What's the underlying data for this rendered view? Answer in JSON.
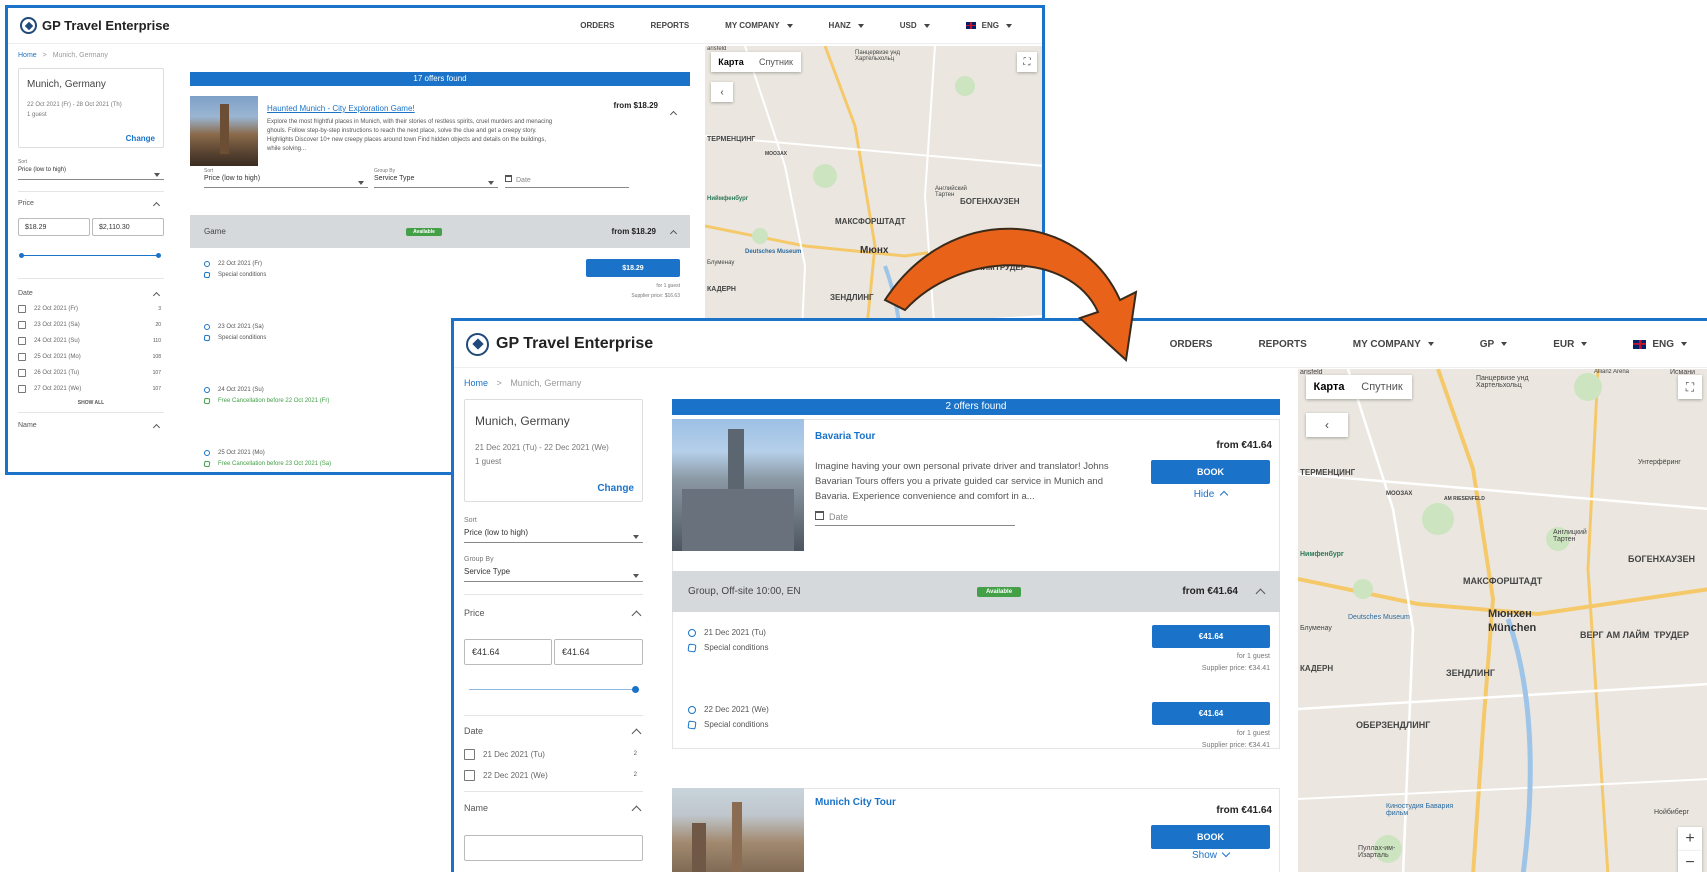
{
  "back": {
    "logo_text": "GP Travel Enterprise",
    "nav": {
      "orders": "ORDERS",
      "reports": "REPORTS",
      "company": "MY COMPANY",
      "user": "HANZ",
      "currency": "USD",
      "lang": "ENG"
    },
    "breadcrumb": {
      "home": "Home",
      "sep": ">",
      "current": "Munich, Germany"
    },
    "search": {
      "city": "Munich, Germany",
      "dates": "22 Oct 2021 (Fr) - 28 Oct 2021 (Th)",
      "guests": "1 guest",
      "change": "Change"
    },
    "sort": {
      "label": "Sort",
      "value": "Price (low to high)"
    },
    "price": {
      "title": "Price",
      "min": "$18.29",
      "max": "$2,110.30"
    },
    "date_filter": {
      "title": "Date",
      "items": [
        {
          "label": "22 Oct 2021 (Fr)",
          "count": "3"
        },
        {
          "label": "23 Oct 2021 (Sa)",
          "count": "20"
        },
        {
          "label": "24 Oct 2021 (Su)",
          "count": "110"
        },
        {
          "label": "25 Oct 2021 (Mo)",
          "count": "108"
        },
        {
          "label": "26 Oct 2021 (Tu)",
          "count": "107"
        },
        {
          "label": "27 Oct 2021 (We)",
          "count": "107"
        }
      ],
      "show_all": "SHOW ALL"
    },
    "name_filter": {
      "title": "Name"
    },
    "results_bar": "17 offers found",
    "offer": {
      "title": "Haunted Munich - City Exploration Game!",
      "price": "from $18.29",
      "desc": "Explore the most frightful places in Munich, with their stories of restless spirits, cruel murders and menacing ghouls. Follow step-by-step instructions to reach the next place, solve the clue and get a creepy story. Highlights Discover 10+ new creepy places around town Find hidden objects and details on the buildings, while solving..."
    },
    "controls": {
      "sort_label": "Sort",
      "sort_value": "Price (low to high)",
      "group_label": "Group By",
      "group_value": "Service Type",
      "date_placeholder": "Date"
    },
    "group": {
      "name": "Game",
      "badge": "Available",
      "price": "from $18.29"
    },
    "rows": [
      {
        "date": "22 Oct 2021 (Fr)",
        "cond": "Special conditions"
      },
      {
        "date": "23 Oct 2021 (Sa)",
        "cond": "Special conditions"
      },
      {
        "date": "24 Oct 2021 (Su)",
        "cond": "Free Cancellation before 22 Oct 2021 (Fr)"
      },
      {
        "date": "25 Oct 2021 (Mo)",
        "cond": "Free Cancellation before 23 Oct 2021 (Sa)"
      }
    ],
    "first_row": {
      "button": "$18.29",
      "for": "for 1 guest",
      "supplier": "Supplier price: $16.63"
    },
    "map": {
      "tab_map": "Карта",
      "tab_sat": "Спутник"
    }
  },
  "front": {
    "logo_text": "GP Travel Enterprise",
    "nav": {
      "orders": "ORDERS",
      "reports": "REPORTS",
      "company": "MY COMPANY",
      "user": "GP",
      "currency": "EUR",
      "lang": "ENG"
    },
    "breadcrumb": {
      "home": "Home",
      "sep": ">",
      "current": "Munich, Germany"
    },
    "search": {
      "city": "Munich, Germany",
      "dates": "21 Dec 2021 (Tu) - 22 Dec 2021 (We)",
      "guests": "1 guest",
      "change": "Change"
    },
    "sort": {
      "label": "Sort",
      "value": "Price (low to high)"
    },
    "group": {
      "label": "Group By",
      "value": "Service Type"
    },
    "price": {
      "title": "Price",
      "min": "€41.64",
      "max": "€41.64"
    },
    "date_filter": {
      "title": "Date",
      "items": [
        {
          "label": "21 Dec 2021 (Tu)",
          "count": "2"
        },
        {
          "label": "22 Dec 2021 (We)",
          "count": "2"
        }
      ]
    },
    "name_filter": {
      "title": "Name"
    },
    "results_bar": "2 offers found",
    "offer1": {
      "title": "Bavaria Tour",
      "price": "from €41.64",
      "desc": "Imagine having your own personal private driver and translator! Johns Bavarian Tours offers you a private guided car service in Munich and Bavaria. Experience convenience and comfort in a...",
      "book": "BOOK",
      "toggle": "Hide",
      "date_placeholder": "Date"
    },
    "group_row": {
      "name": "Group, Off-site 10:00, EN",
      "badge": "Available",
      "price": "from €41.64"
    },
    "rows": [
      {
        "date": "21 Dec 2021 (Tu)",
        "cond": "Special conditions",
        "button": "€41.64",
        "for": "for 1 guest",
        "supplier": "Supplier price: €34.41"
      },
      {
        "date": "22 Dec 2021 (We)",
        "cond": "Special conditions",
        "button": "€41.64",
        "for": "for 1 guest",
        "supplier": "Supplier price: €34.41"
      }
    ],
    "offer2": {
      "title": "Munich City Tour",
      "price": "from €41.64",
      "book": "BOOK",
      "toggle": "Show"
    },
    "map": {
      "tab_map": "Карта",
      "tab_sat": "Спутник",
      "zoom_in": "+",
      "zoom_out": "−"
    }
  },
  "map_labels": {
    "back": [
      "arisfeld",
      "Панцервизе унд Хартельхольц",
      "ТЕРМЕНЦИНГ",
      "МООЗАХ",
      "Ниймфенбург",
      "МАКСФОРШТАДТ",
      "Мюнх",
      "Deutsches Museum",
      "БОГЕНХАУЗЕН",
      "ВЕРГ АМ ЛАЙМ",
      "ТРУДЕР",
      "КАДЕРН",
      "ЗЕНДЛИНГ",
      "Английский Тартен",
      "Блуменау"
    ],
    "front": [
      "arisfeld",
      "Панцервизе унд Хартельхольц",
      "Allianz Arena",
      "Исмани",
      "ТЕРМЕНЦИНГ",
      "МООЗАХ",
      "AM RIESENFELD",
      "Унтерфёринг",
      "Нимфенбург",
      "Англицкий Тартен",
      "БОГЕНХАУЗЕН",
      "МАКСФОРШТАДТ",
      "Deutsches Museum",
      "Мюнхен",
      "München",
      "ВЕРГ АМ ЛАЙМ",
      "ТРУДЕР",
      "Блуменау",
      "КАДЕРН",
      "ЗЕНДЛИНГ",
      "ОБЕРЗЕНДЛИНГ",
      "Киностудия Бавария фильм",
      "Пуллах-им-Изарталь",
      "Нойбиберг"
    ]
  }
}
